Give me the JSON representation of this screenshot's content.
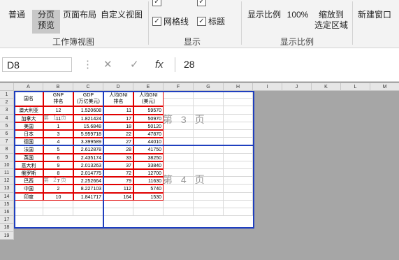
{
  "ribbon": {
    "view_group": {
      "normal": "普通",
      "page_break_line1": "分页",
      "page_break_line2": "预览",
      "page_layout": "页面布局",
      "custom_views": "自定义视图",
      "group_label": "工作簿视图"
    },
    "show_group": {
      "gridlines": "网格线",
      "headings": "标题",
      "group_label": "显示"
    },
    "zoom_group": {
      "zoom": "显示比例",
      "zoom_100": "100%",
      "zoom_selection_line1": "缩放到",
      "zoom_selection_line2": "选定区域",
      "group_label": "显示比例"
    },
    "window_group": {
      "new_window": "新建窗口"
    }
  },
  "formula_bar": {
    "name_box": "D8",
    "fx": "fx",
    "value": "28"
  },
  "columns": [
    "A",
    "B",
    "C",
    "D",
    "E",
    "F",
    "G",
    "H",
    "I",
    "J",
    "K",
    "L",
    "M"
  ],
  "rows": [
    "1",
    "2",
    "3",
    "4",
    "5",
    "6",
    "7",
    "8",
    "9",
    "10",
    "11",
    "12",
    "13",
    "14",
    "15",
    "16",
    "17",
    "18",
    "19"
  ],
  "table": {
    "headers": {
      "a": "国名",
      "b1": "GNP",
      "b2": "排名",
      "c1": "GDP",
      "c2": "(万亿美元)",
      "d1": "人均GNI",
      "d2": "排名",
      "e1": "人均GNI",
      "e2": "(美元)"
    },
    "data": [
      [
        "澳大利亚",
        "12",
        "1.520608",
        "11",
        "59570"
      ],
      [
        "加拿大",
        "11",
        "1.821424",
        "17",
        "50970"
      ],
      [
        "美国",
        "1",
        "15.6848",
        "18",
        "50120"
      ],
      [
        "日本",
        "3",
        "5.959718",
        "22",
        "47870"
      ],
      [
        "德国",
        "4",
        "3.399589",
        "27",
        "44010"
      ],
      [
        "法国",
        "5",
        "2.612878",
        "28",
        "41750"
      ],
      [
        "英国",
        "6",
        "2.435174",
        "33",
        "38250"
      ],
      [
        "意大利",
        "9",
        "2.013263",
        "37",
        "33840"
      ],
      [
        "俄罗斯",
        "8",
        "2.014775",
        "72",
        "12700"
      ],
      [
        "巴西",
        "7",
        "2.252664",
        "79",
        "11630"
      ],
      [
        "中国",
        "2",
        "8.227103",
        "112",
        "5740"
      ],
      [
        "印度",
        "10",
        "1.841717",
        "164",
        "1530"
      ]
    ]
  },
  "watermarks": {
    "p1": "第 1 页",
    "p2": "第 2 页",
    "p3": "第 3 页",
    "p4": "第 4 页"
  }
}
